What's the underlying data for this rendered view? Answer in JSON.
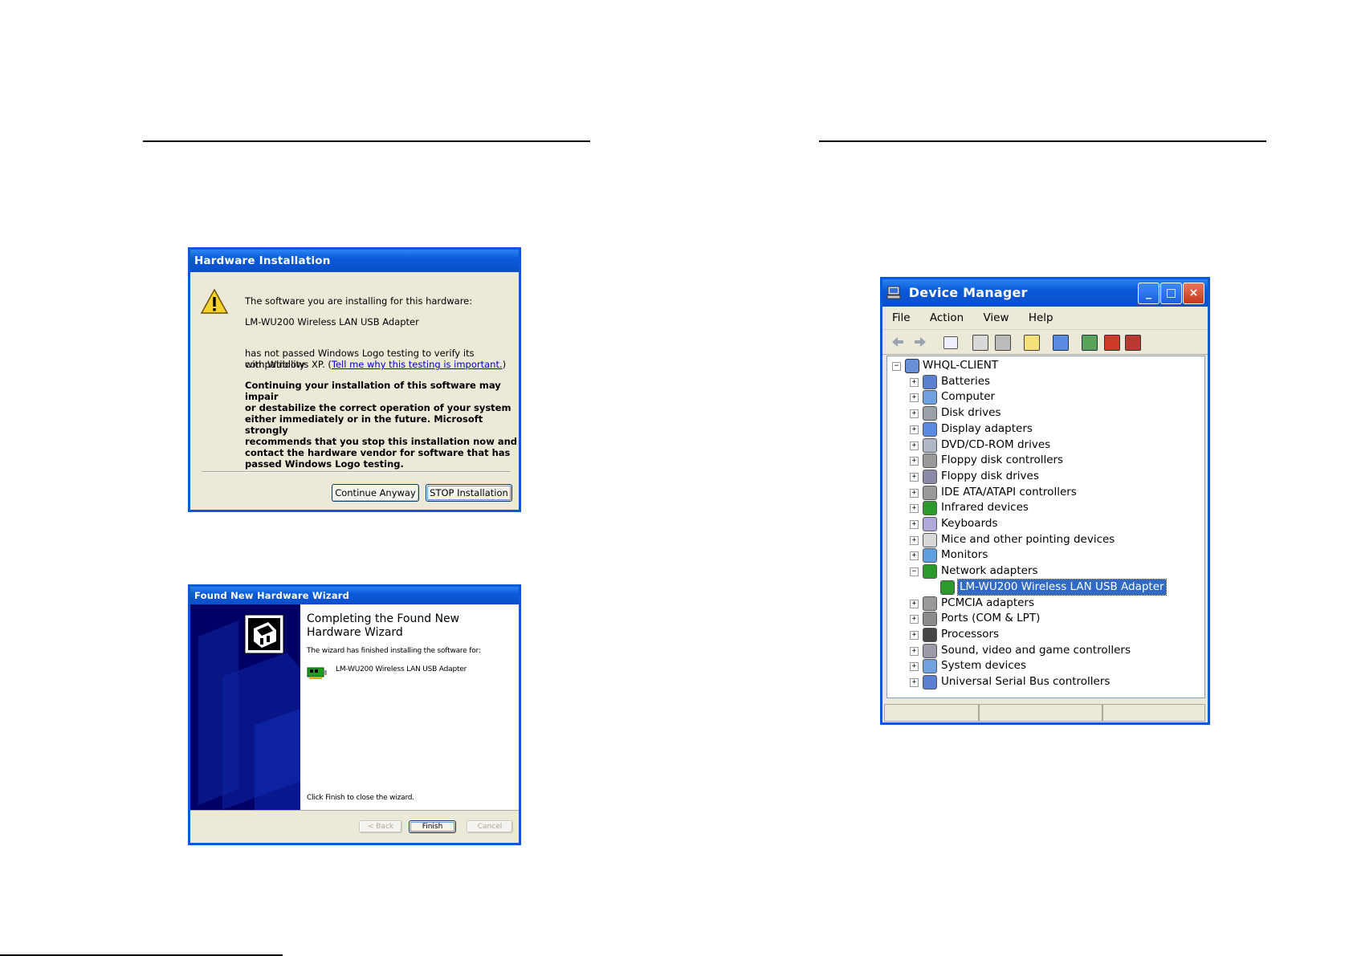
{
  "hw_install": {
    "title": "Hardware Installation",
    "line1": "The software you are installing for this hardware:",
    "device": "LM-WU200 Wireless LAN USB Adapter",
    "line3a": "has not passed Windows Logo testing to verify its compatibility",
    "line3b": "with Windows XP. (",
    "link": "Tell me why this testing is important.",
    "line3c": ")",
    "warning": [
      "Continuing your installation of this software may impair",
      "or destabilize the correct operation of your system",
      "either immediately or in the future. Microsoft strongly",
      "recommends that you stop this installation now and",
      "contact the hardware vendor for software that has",
      "passed Windows Logo testing."
    ],
    "continue_label": "Continue Anyway",
    "stop_label": "STOP Installation"
  },
  "found_wizard": {
    "title": "Found New Hardware Wizard",
    "heading1": "Completing the Found New",
    "heading2": "Hardware Wizard",
    "finished_text": "The wizard has finished installing the software for:",
    "device": "LM-WU200 Wireless LAN USB Adapter",
    "close_text": "Click Finish to close the wizard.",
    "back_label": "< Back",
    "finish_label": "Finish",
    "cancel_label": "Cancel"
  },
  "device_manager": {
    "title": "Device Manager",
    "menu": [
      "File",
      "Action",
      "View",
      "Help"
    ],
    "root": "WHQL-CLIENT",
    "items": [
      "Batteries",
      "Computer",
      "Disk drives",
      "Display adapters",
      "DVD/CD-ROM drives",
      "Floppy disk controllers",
      "Floppy disk drives",
      "IDE ATA/ATAPI controllers",
      "Infrared devices",
      "Keyboards",
      "Mice and other pointing devices",
      "Monitors",
      "Network adapters"
    ],
    "selected_child": "LM-WU200 Wireless LAN USB Adapter",
    "items_after": [
      "PCMCIA adapters",
      "Ports (COM & LPT)",
      "Processors",
      "Sound, video and game controllers",
      "System devices",
      "Universal Serial Bus controllers"
    ],
    "minimize_glyph": "_",
    "maximize_glyph": "□",
    "close_glyph": "×"
  }
}
